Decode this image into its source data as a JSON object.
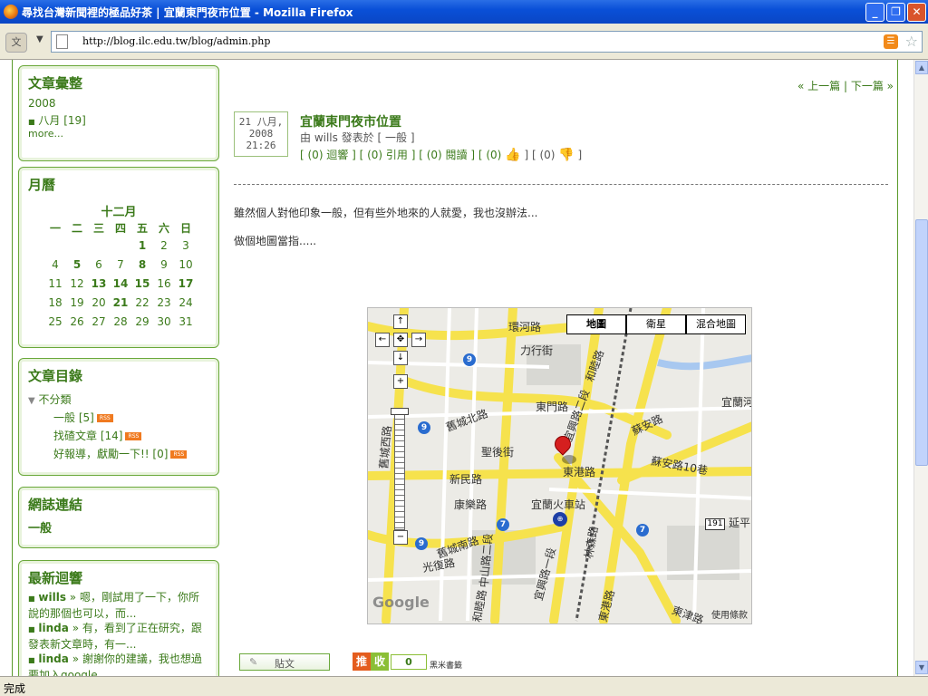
{
  "window": {
    "title": "尋找台灣新聞裡的極品好茶 | 宜蘭東門夜市位置 - Mozilla Firefox",
    "controls": {
      "minimize": "_",
      "maximize": "❐",
      "close": "✕"
    }
  },
  "nav": {
    "url": "http://blog.ilc.edu.tw/blog/admin.php",
    "rss_label": "RSS"
  },
  "status": {
    "text": "完成"
  },
  "sidebar": {
    "archive": {
      "title": "文章彙整",
      "year": "2008",
      "month": "八月 [19]",
      "more": "more..."
    },
    "calendar": {
      "title": "月曆",
      "month": "十二月",
      "weekdays": [
        "一",
        "二",
        "三",
        "四",
        "五",
        "六",
        "日"
      ],
      "weeks": [
        [
          "",
          "",
          "",
          "",
          "1",
          "2",
          "3"
        ],
        [
          "4",
          "5",
          "6",
          "7",
          "8",
          "9",
          "10"
        ],
        [
          "11",
          "12",
          "13",
          "14",
          "15",
          "16",
          "17"
        ],
        [
          "18",
          "19",
          "20",
          "21",
          "22",
          "23",
          "24"
        ],
        [
          "25",
          "26",
          "27",
          "28",
          "29",
          "30",
          "31"
        ]
      ],
      "bold_days": [
        "1",
        "5",
        "8",
        "13",
        "14",
        "15",
        "17",
        "21"
      ]
    },
    "categories": {
      "title": "文章目錄",
      "root": "不分類",
      "items": [
        "一般 [5]",
        "找碴文章 [14]",
        "好報導，獻勵一下!! [0]"
      ]
    },
    "links": {
      "title": "網誌連結",
      "item": "一般"
    },
    "comments": {
      "title": "最新迴響",
      "items": [
        {
          "author": "wills",
          "text": "» 嗯，剛試用了一下，你所說的那個也可以，而..."
        },
        {
          "author": "linda",
          "text": "» 有，看到了正在研究，跟發表新文章時，有一..."
        },
        {
          "author": "linda",
          "text": "» 謝謝你的建議，我也想過要加入google..."
        }
      ]
    }
  },
  "post": {
    "date": [
      "21 八月,",
      "2008",
      "21:26"
    ],
    "title": "宜蘭東門夜市位置",
    "meta": "由 wills 發表於 [ 一般 ]",
    "actions": "[ (0) 迴響 ] [ (0) 引用 ] [ (0) 閱讀 ] [ (0)",
    "actions_tail": "] [ (0)",
    "actions_end": "]",
    "prev_next": "« 上一篇 | 下一篇 »",
    "body": [
      "雖然個人對他印象一般，但有些外地來的人就愛，我也沒辦法...",
      "做個地圖當指....."
    ]
  },
  "map": {
    "types": [
      "地圖",
      "衛星",
      "混合地圖"
    ],
    "roads": [
      "環河路",
      "力行街",
      "和睦路",
      "宜蘭河",
      "光復路",
      "東港路",
      "蘇安路",
      "宜興路二段",
      "舊城北路",
      "聖後街",
      "新民路",
      "康樂路",
      "宜蘭火車站",
      "林森路",
      "蘇安路10巷",
      "延平",
      "舊城西路",
      "中山路二段",
      "舊城南路",
      "宜興路一段",
      "東津路",
      "和睦路",
      "東門路",
      "東港路"
    ],
    "shields": [
      "9",
      "9",
      "7",
      "7",
      "9",
      "191"
    ],
    "logo": "Google",
    "copyright": "使用條款"
  },
  "footer": {
    "post_button": "貼文",
    "push": "推",
    "collect": "收",
    "count": "0",
    "bookmark_label": "黑米書籤"
  }
}
